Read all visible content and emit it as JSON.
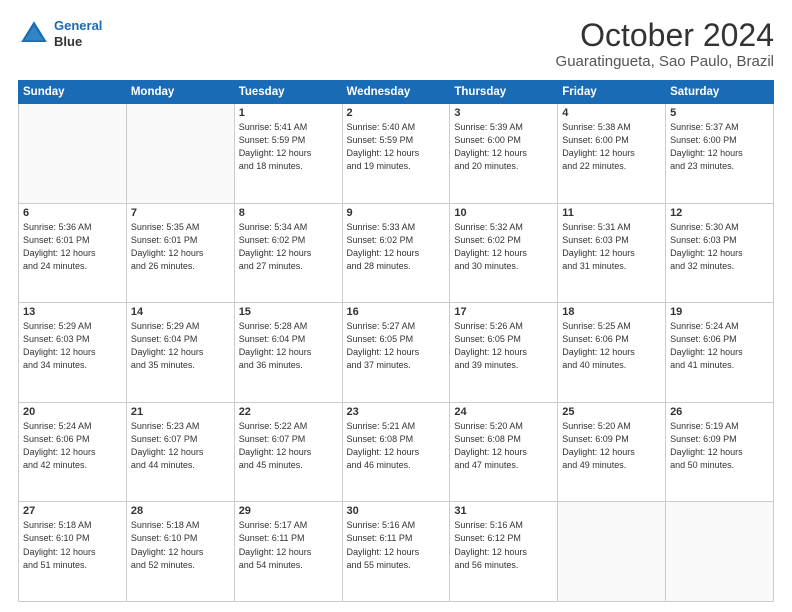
{
  "header": {
    "logo_line1": "General",
    "logo_line2": "Blue",
    "month": "October 2024",
    "location": "Guaratingueta, Sao Paulo, Brazil"
  },
  "days_of_week": [
    "Sunday",
    "Monday",
    "Tuesday",
    "Wednesday",
    "Thursday",
    "Friday",
    "Saturday"
  ],
  "weeks": [
    [
      {
        "day": "",
        "info": ""
      },
      {
        "day": "",
        "info": ""
      },
      {
        "day": "1",
        "info": "Sunrise: 5:41 AM\nSunset: 5:59 PM\nDaylight: 12 hours\nand 18 minutes."
      },
      {
        "day": "2",
        "info": "Sunrise: 5:40 AM\nSunset: 5:59 PM\nDaylight: 12 hours\nand 19 minutes."
      },
      {
        "day": "3",
        "info": "Sunrise: 5:39 AM\nSunset: 6:00 PM\nDaylight: 12 hours\nand 20 minutes."
      },
      {
        "day": "4",
        "info": "Sunrise: 5:38 AM\nSunset: 6:00 PM\nDaylight: 12 hours\nand 22 minutes."
      },
      {
        "day": "5",
        "info": "Sunrise: 5:37 AM\nSunset: 6:00 PM\nDaylight: 12 hours\nand 23 minutes."
      }
    ],
    [
      {
        "day": "6",
        "info": "Sunrise: 5:36 AM\nSunset: 6:01 PM\nDaylight: 12 hours\nand 24 minutes."
      },
      {
        "day": "7",
        "info": "Sunrise: 5:35 AM\nSunset: 6:01 PM\nDaylight: 12 hours\nand 26 minutes."
      },
      {
        "day": "8",
        "info": "Sunrise: 5:34 AM\nSunset: 6:02 PM\nDaylight: 12 hours\nand 27 minutes."
      },
      {
        "day": "9",
        "info": "Sunrise: 5:33 AM\nSunset: 6:02 PM\nDaylight: 12 hours\nand 28 minutes."
      },
      {
        "day": "10",
        "info": "Sunrise: 5:32 AM\nSunset: 6:02 PM\nDaylight: 12 hours\nand 30 minutes."
      },
      {
        "day": "11",
        "info": "Sunrise: 5:31 AM\nSunset: 6:03 PM\nDaylight: 12 hours\nand 31 minutes."
      },
      {
        "day": "12",
        "info": "Sunrise: 5:30 AM\nSunset: 6:03 PM\nDaylight: 12 hours\nand 32 minutes."
      }
    ],
    [
      {
        "day": "13",
        "info": "Sunrise: 5:29 AM\nSunset: 6:03 PM\nDaylight: 12 hours\nand 34 minutes."
      },
      {
        "day": "14",
        "info": "Sunrise: 5:29 AM\nSunset: 6:04 PM\nDaylight: 12 hours\nand 35 minutes."
      },
      {
        "day": "15",
        "info": "Sunrise: 5:28 AM\nSunset: 6:04 PM\nDaylight: 12 hours\nand 36 minutes."
      },
      {
        "day": "16",
        "info": "Sunrise: 5:27 AM\nSunset: 6:05 PM\nDaylight: 12 hours\nand 37 minutes."
      },
      {
        "day": "17",
        "info": "Sunrise: 5:26 AM\nSunset: 6:05 PM\nDaylight: 12 hours\nand 39 minutes."
      },
      {
        "day": "18",
        "info": "Sunrise: 5:25 AM\nSunset: 6:06 PM\nDaylight: 12 hours\nand 40 minutes."
      },
      {
        "day": "19",
        "info": "Sunrise: 5:24 AM\nSunset: 6:06 PM\nDaylight: 12 hours\nand 41 minutes."
      }
    ],
    [
      {
        "day": "20",
        "info": "Sunrise: 5:24 AM\nSunset: 6:06 PM\nDaylight: 12 hours\nand 42 minutes."
      },
      {
        "day": "21",
        "info": "Sunrise: 5:23 AM\nSunset: 6:07 PM\nDaylight: 12 hours\nand 44 minutes."
      },
      {
        "day": "22",
        "info": "Sunrise: 5:22 AM\nSunset: 6:07 PM\nDaylight: 12 hours\nand 45 minutes."
      },
      {
        "day": "23",
        "info": "Sunrise: 5:21 AM\nSunset: 6:08 PM\nDaylight: 12 hours\nand 46 minutes."
      },
      {
        "day": "24",
        "info": "Sunrise: 5:20 AM\nSunset: 6:08 PM\nDaylight: 12 hours\nand 47 minutes."
      },
      {
        "day": "25",
        "info": "Sunrise: 5:20 AM\nSunset: 6:09 PM\nDaylight: 12 hours\nand 49 minutes."
      },
      {
        "day": "26",
        "info": "Sunrise: 5:19 AM\nSunset: 6:09 PM\nDaylight: 12 hours\nand 50 minutes."
      }
    ],
    [
      {
        "day": "27",
        "info": "Sunrise: 5:18 AM\nSunset: 6:10 PM\nDaylight: 12 hours\nand 51 minutes."
      },
      {
        "day": "28",
        "info": "Sunrise: 5:18 AM\nSunset: 6:10 PM\nDaylight: 12 hours\nand 52 minutes."
      },
      {
        "day": "29",
        "info": "Sunrise: 5:17 AM\nSunset: 6:11 PM\nDaylight: 12 hours\nand 54 minutes."
      },
      {
        "day": "30",
        "info": "Sunrise: 5:16 AM\nSunset: 6:11 PM\nDaylight: 12 hours\nand 55 minutes."
      },
      {
        "day": "31",
        "info": "Sunrise: 5:16 AM\nSunset: 6:12 PM\nDaylight: 12 hours\nand 56 minutes."
      },
      {
        "day": "",
        "info": ""
      },
      {
        "day": "",
        "info": ""
      }
    ]
  ]
}
